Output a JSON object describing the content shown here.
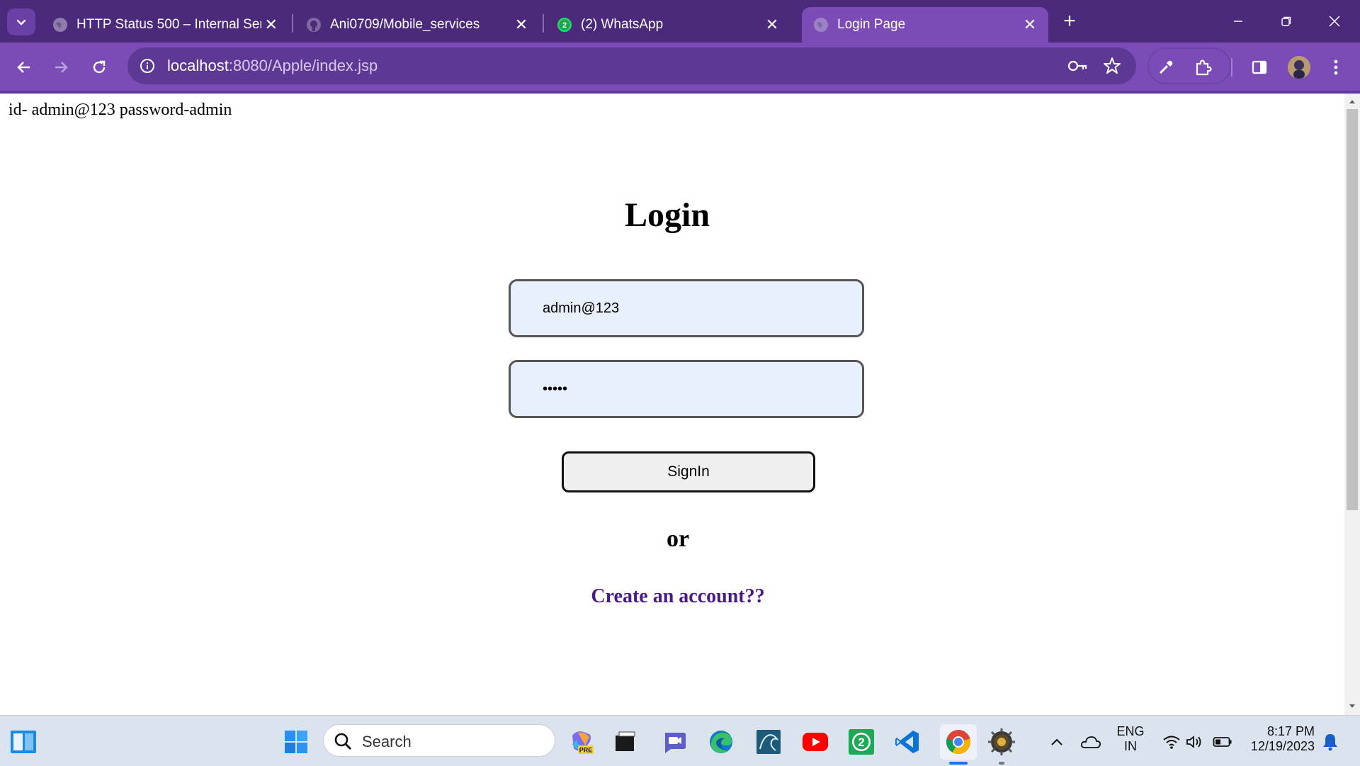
{
  "browser": {
    "tabs": [
      {
        "title": "HTTP Status 500 – Internal Serv",
        "favicon": "globe-icon",
        "active": false
      },
      {
        "title": "Ani0709/Mobile_services",
        "favicon": "github-icon",
        "active": false
      },
      {
        "title": "(2) WhatsApp",
        "favicon": "whatsapp-icon",
        "badge": "2",
        "active": false
      },
      {
        "title": "Login Page",
        "favicon": "globe-icon",
        "active": true
      }
    ],
    "url_host": "localhost",
    "url_rest": ":8080/Apple/index.jsp",
    "colors": {
      "frame": "#4b2a7b",
      "toolbar": "#7b4bb7",
      "omnibox": "#5d3995"
    }
  },
  "page": {
    "hint": "id- admin@123 password-admin",
    "title": "Login",
    "username_value": "admin@123",
    "password_value": "admin",
    "signin_label": "SignIn",
    "or_text": "or",
    "create_link": "Create an account??"
  },
  "taskbar": {
    "search_placeholder": "Search",
    "lang_line1": "ENG",
    "lang_line2": "IN",
    "time": "8:17 PM",
    "date": "12/19/2023",
    "pinned": [
      "widgets-icon",
      "windows-start-icon",
      "search-icon",
      "copilot-pre-icon",
      "file-explorer-icon",
      "teams-icon",
      "edge-icon",
      "mysql-workbench-icon",
      "youtube-icon",
      "whatsapp-icon",
      "vscode-icon",
      "chrome-icon",
      "tomcat-icon"
    ]
  }
}
